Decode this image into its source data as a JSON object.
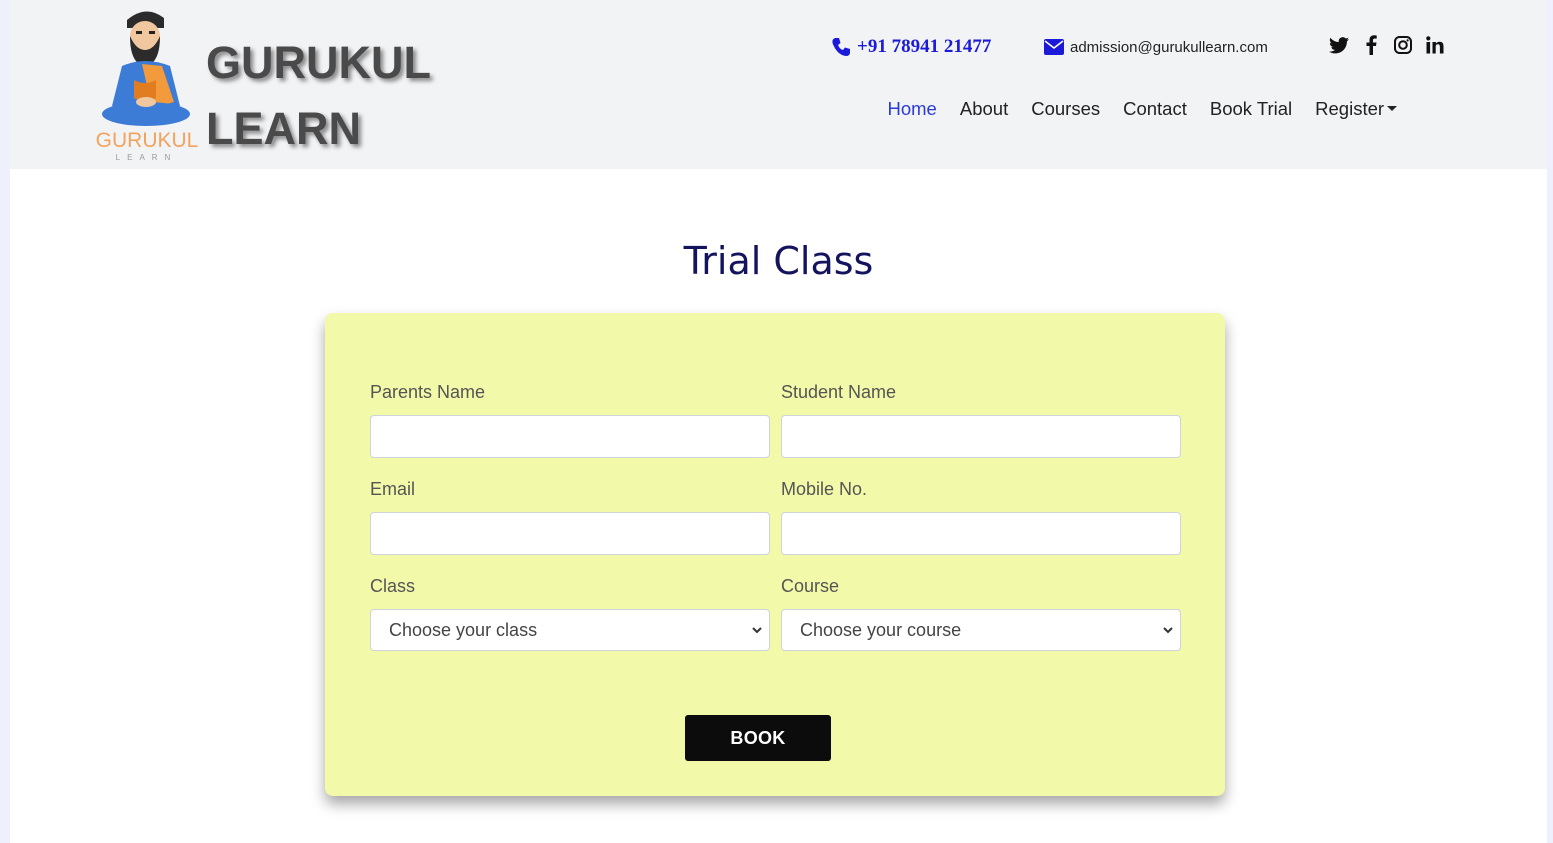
{
  "brand": {
    "line1": "GURUKUL",
    "line2": "LEARN",
    "logo_text": "GURUKUL",
    "logo_sub": "LEARN"
  },
  "contact": {
    "phone": "+91 78941 21477",
    "email": "admission@gurukullearn.com"
  },
  "socials": [
    "twitter-icon",
    "facebook-icon",
    "instagram-icon",
    "linkedin-icon"
  ],
  "nav": {
    "items": [
      "Home",
      "About",
      "Courses",
      "Contact",
      "Book Trial",
      "Register"
    ],
    "active": "Home"
  },
  "page": {
    "title": "Trial Class"
  },
  "form": {
    "parents_name_label": "Parents Name",
    "student_name_label": "Student Name",
    "email_label": "Email",
    "mobile_label": "Mobile No.",
    "class_label": "Class",
    "class_selected": "Choose your class",
    "course_label": "Course",
    "course_selected": "Choose your course",
    "submit_label": "BOOK"
  },
  "colors": {
    "card_bg": "#f2f9a9",
    "active_nav": "#2a3bd6",
    "title": "#14145e",
    "phone": "#1a1ad8"
  }
}
